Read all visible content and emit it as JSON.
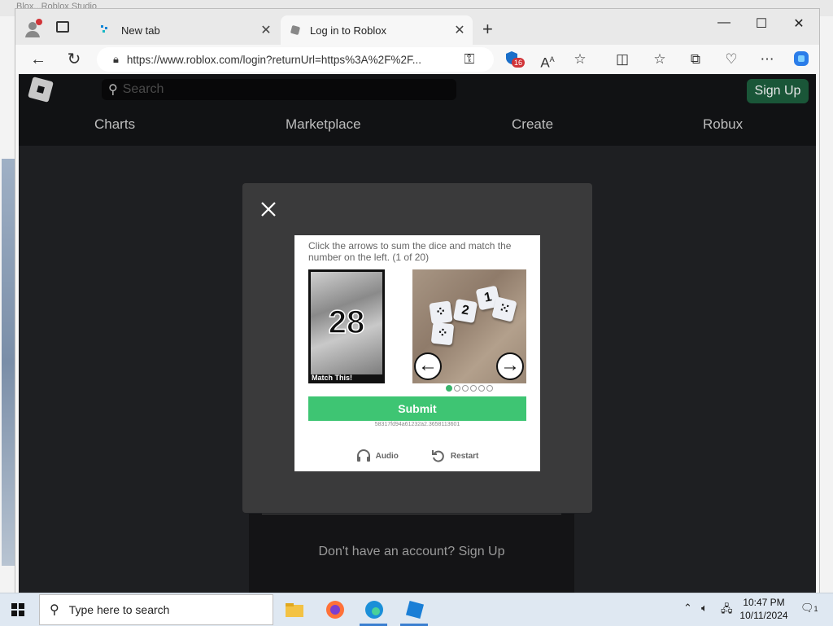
{
  "background_window": {
    "title": "Blox...Roblox Studio"
  },
  "browser": {
    "tabs": [
      {
        "label": "New tab",
        "close": "✕"
      },
      {
        "label": "Log in to Roblox",
        "close": "✕"
      }
    ],
    "new_tab_symbol": "+",
    "window_controls": [
      "—",
      "☐",
      "✕"
    ],
    "url": "https://www.roblox.com/login?returnUrl=https%3A%2F%2F...",
    "badge_count": "16"
  },
  "roblox": {
    "search_placeholder": "Search",
    "signup_button": "Sign Up",
    "nav": [
      "Charts",
      "Marketplace",
      "Create",
      "Robux"
    ],
    "no_account_text": "Don't have an account? Sign Up"
  },
  "captcha": {
    "instruction": "Click the arrows to sum the dice and match the number on the left. (1 of 20)",
    "match_number": "28",
    "match_label": "Match This!",
    "dice_values": [
      "1",
      "2"
    ],
    "page_dots_total": 6,
    "page_dots_active": 1,
    "submit_label": "Submit",
    "hash": "58317fd94a61232a2.3658113601",
    "audio_label": "Audio",
    "restart_label": "Restart"
  },
  "taskbar": {
    "search_placeholder": "Type here to search",
    "time": "10:47 PM",
    "date": "10/11/2024",
    "notification_count": "1"
  },
  "colors": {
    "submit_green": "#3ec573",
    "signup_green": "#1c5e3c",
    "page_bg": "#1e1f22",
    "modal_bg": "#3a3a3b"
  }
}
